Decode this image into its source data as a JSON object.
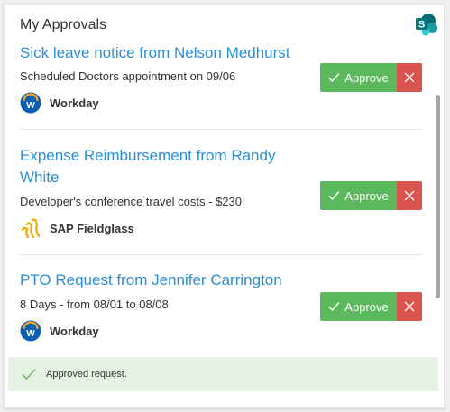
{
  "header": {
    "title": "My Approvals",
    "logo_icon": "sharepoint-icon"
  },
  "items": [
    {
      "title": "Sick leave notice from Nelson Medhurst",
      "description": "Scheduled Doctors appointment on 09/06",
      "source": "Workday",
      "source_icon": "workday-icon",
      "approve_label": "Approve"
    },
    {
      "title": "Expense Reimbursement from Randy White",
      "description": "Developer's conference travel costs - $230",
      "source": "SAP Fieldglass",
      "source_icon": "sap-fieldglass-icon",
      "approve_label": "Approve"
    },
    {
      "title": "PTO Request from Jennifer Carrington",
      "description": "8 Days - from 08/01 to 08/08",
      "source": "Workday",
      "source_icon": "workday-icon",
      "approve_label": "Approve"
    }
  ],
  "toast": {
    "message": "Approved request."
  },
  "colors": {
    "link": "#2b8fd6",
    "approve": "#5cb85c",
    "reject": "#d9534f",
    "toast_bg": "#e6f2e1"
  }
}
